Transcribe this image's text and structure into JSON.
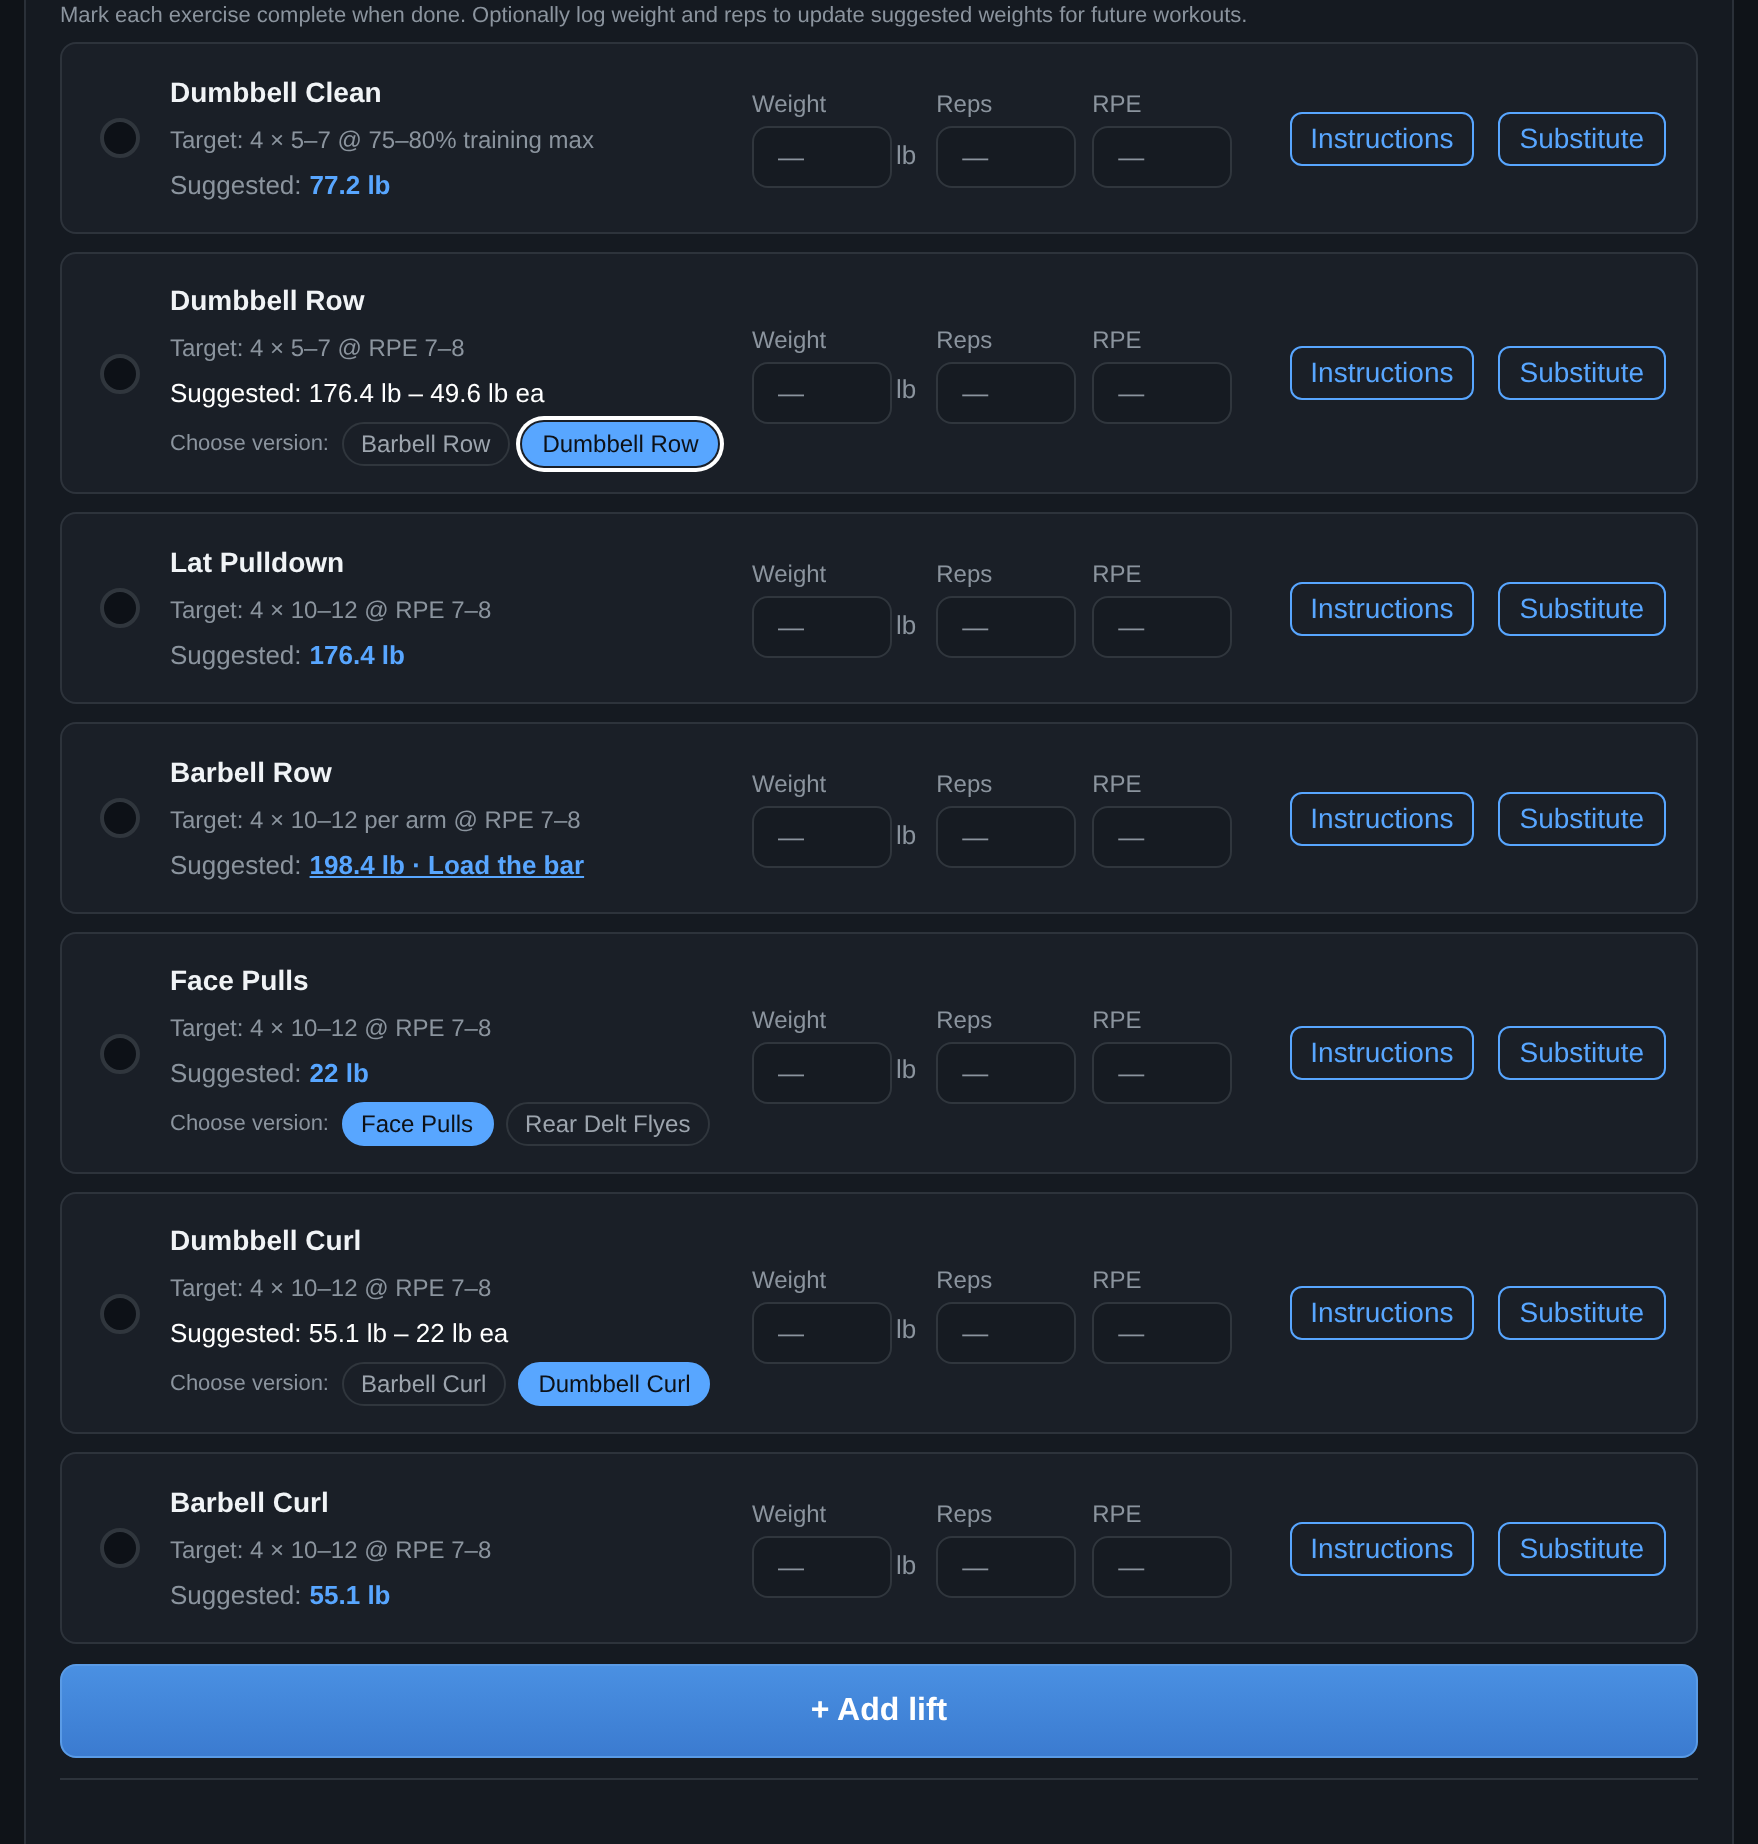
{
  "intro": "Mark each exercise complete when done. Optionally log weight and reps to update suggested weights for future workouts.",
  "exercises": [
    {
      "name": "Dumbbell Clean",
      "done": false,
      "target": "Target: 4 × 5–7 @ 75–80% training max",
      "suggested": {
        "kind": "value",
        "label": "Suggested:",
        "value": "77.2 lb"
      },
      "weight_label": "Weight",
      "weight_placeholder": "—",
      "unit": "lb",
      "reps_label": "Reps",
      "reps_placeholder": "—",
      "rpe_label": "RPE",
      "rpe_placeholder": "—",
      "instructions": "Instructions",
      "substitute": "Substitute"
    },
    {
      "name": "Dumbbell Row",
      "done": false,
      "target": "Target: 4 × 5–7 @ RPE 7–8",
      "suggested": {
        "kind": "split",
        "label": "Suggested:",
        "value": "176.4 lb – 49.6 lb ea"
      },
      "versions_label": "Choose version:",
      "versions": [
        {
          "label": "Barbell Row",
          "selected": false,
          "focused": false
        },
        {
          "label": "Dumbbell Row",
          "selected": true,
          "focused": true
        }
      ],
      "weight_label": "Weight",
      "weight_placeholder": "—",
      "unit": "lb",
      "reps_label": "Reps",
      "reps_placeholder": "—",
      "rpe_label": "RPE",
      "rpe_placeholder": "—",
      "instructions": "Instructions",
      "substitute": "Substitute"
    },
    {
      "name": "Lat Pulldown",
      "done": false,
      "target": "Target: 4 × 10–12 @ RPE 7–8",
      "suggested": {
        "kind": "value",
        "label": "Suggested:",
        "value": "176.4 lb"
      },
      "weight_label": "Weight",
      "weight_placeholder": "—",
      "unit": "lb",
      "reps_label": "Reps",
      "reps_placeholder": "—",
      "rpe_label": "RPE",
      "rpe_placeholder": "—",
      "instructions": "Instructions",
      "substitute": "Substitute"
    },
    {
      "name": "Barbell Row",
      "done": false,
      "target": "Target: 4 × 10–12 per arm @ RPE 7–8",
      "suggested": {
        "kind": "link",
        "label": "Suggested:",
        "value": "198.4 lb · Load the bar"
      },
      "weight_label": "Weight",
      "weight_placeholder": "—",
      "unit": "lb",
      "reps_label": "Reps",
      "reps_placeholder": "—",
      "rpe_label": "RPE",
      "rpe_placeholder": "—",
      "instructions": "Instructions",
      "substitute": "Substitute"
    },
    {
      "name": "Face Pulls",
      "done": false,
      "target": "Target: 4 × 10–12 @ RPE 7–8",
      "suggested": {
        "kind": "value",
        "label": "Suggested:",
        "value": "22 lb"
      },
      "versions_label": "Choose version:",
      "versions": [
        {
          "label": "Face Pulls",
          "selected": true,
          "focused": false
        },
        {
          "label": "Rear Delt Flyes",
          "selected": false,
          "focused": false
        }
      ],
      "weight_label": "Weight",
      "weight_placeholder": "—",
      "unit": "lb",
      "reps_label": "Reps",
      "reps_placeholder": "—",
      "rpe_label": "RPE",
      "rpe_placeholder": "—",
      "instructions": "Instructions",
      "substitute": "Substitute"
    },
    {
      "name": "Dumbbell Curl",
      "done": false,
      "target": "Target: 4 × 10–12 @ RPE 7–8",
      "suggested": {
        "kind": "split",
        "label": "Suggested:",
        "value": "55.1 lb – 22 lb ea"
      },
      "versions_label": "Choose version:",
      "versions": [
        {
          "label": "Barbell Curl",
          "selected": false,
          "focused": false
        },
        {
          "label": "Dumbbell Curl",
          "selected": true,
          "focused": false
        }
      ],
      "weight_label": "Weight",
      "weight_placeholder": "—",
      "unit": "lb",
      "reps_label": "Reps",
      "reps_placeholder": "—",
      "rpe_label": "RPE",
      "rpe_placeholder": "—",
      "instructions": "Instructions",
      "substitute": "Substitute"
    },
    {
      "name": "Barbell Curl",
      "done": false,
      "target": "Target: 4 × 10–12 @ RPE 7–8",
      "suggested": {
        "kind": "value",
        "label": "Suggested:",
        "value": "55.1 lb"
      },
      "weight_label": "Weight",
      "weight_placeholder": "—",
      "unit": "lb",
      "reps_label": "Reps",
      "reps_placeholder": "—",
      "rpe_label": "RPE",
      "rpe_placeholder": "—",
      "instructions": "Instructions",
      "substitute": "Substitute"
    }
  ],
  "add_button": "+ Add lift"
}
